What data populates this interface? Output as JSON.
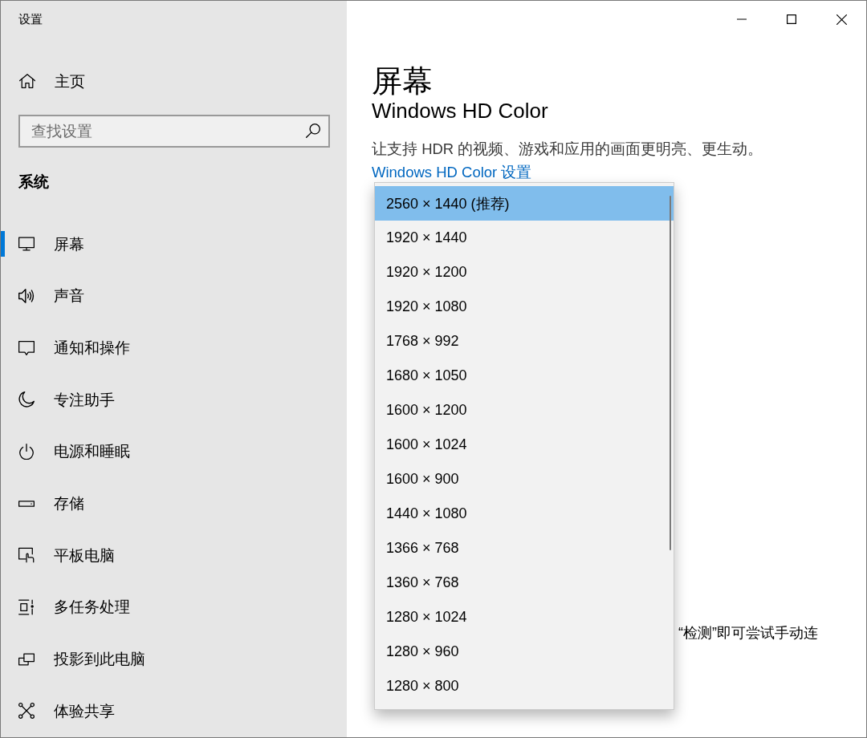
{
  "window": {
    "title": "设置"
  },
  "sidebar": {
    "home": {
      "label": "主页"
    },
    "search": {
      "placeholder": "查找设置"
    },
    "section_title": "系统",
    "items": [
      {
        "label": "屏幕",
        "kind": "display",
        "selected": true
      },
      {
        "label": "声音",
        "kind": "sound",
        "selected": false
      },
      {
        "label": "通知和操作",
        "kind": "notifications",
        "selected": false
      },
      {
        "label": "专注助手",
        "kind": "focus",
        "selected": false
      },
      {
        "label": "电源和睡眠",
        "kind": "power",
        "selected": false
      },
      {
        "label": "存储",
        "kind": "storage",
        "selected": false
      },
      {
        "label": "平板电脑",
        "kind": "tablet",
        "selected": false
      },
      {
        "label": "多任务处理",
        "kind": "multitasking",
        "selected": false
      },
      {
        "label": "投影到此电脑",
        "kind": "projecting",
        "selected": false
      },
      {
        "label": "体验共享",
        "kind": "shared",
        "selected": false
      }
    ]
  },
  "main": {
    "title": "屏幕",
    "section_heading": "Windows HD Color",
    "description": "让支持 HDR 的视频、游戏和应用的画面更明亮、更生动。",
    "link": "Windows HD Color 设置",
    "partial_text": "“检测”即可尝试手动连"
  },
  "resolution_dropdown": {
    "options": [
      {
        "label": "2560 × 1440 (推荐)",
        "selected": true
      },
      {
        "label": "1920 × 1440",
        "selected": false
      },
      {
        "label": "1920 × 1200",
        "selected": false
      },
      {
        "label": "1920 × 1080",
        "selected": false
      },
      {
        "label": "1768 × 992",
        "selected": false
      },
      {
        "label": "1680 × 1050",
        "selected": false
      },
      {
        "label": "1600 × 1200",
        "selected": false
      },
      {
        "label": "1600 × 1024",
        "selected": false
      },
      {
        "label": "1600 × 900",
        "selected": false
      },
      {
        "label": "1440 × 1080",
        "selected": false
      },
      {
        "label": "1366 × 768",
        "selected": false
      },
      {
        "label": "1360 × 768",
        "selected": false
      },
      {
        "label": "1280 × 1024",
        "selected": false
      },
      {
        "label": "1280 × 960",
        "selected": false
      },
      {
        "label": "1280 × 800",
        "selected": false
      }
    ]
  }
}
